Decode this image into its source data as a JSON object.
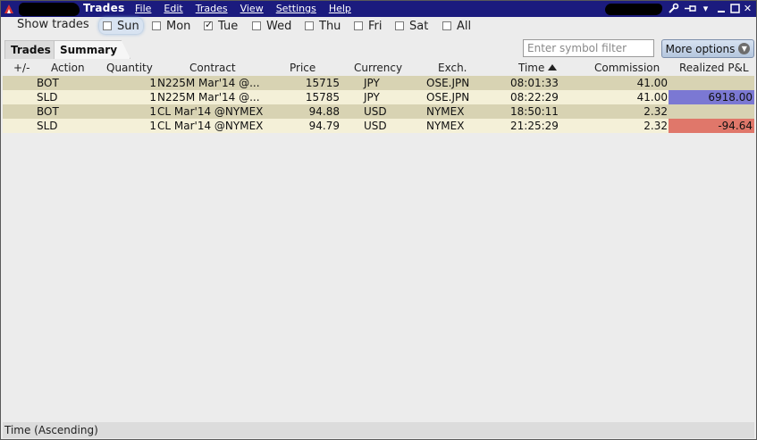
{
  "titlebar": {
    "title": "Trades",
    "menu": [
      "File",
      "Edit",
      "Trades",
      "View",
      "Settings",
      "Help"
    ],
    "controls": {
      "tools": "🔧",
      "pin": "⊣",
      "chevron": "▾",
      "minimize": "‗",
      "maximize": "□",
      "close": "✕"
    }
  },
  "days_row": {
    "label": "Show trades",
    "days": [
      {
        "label": "Sun",
        "checked": false,
        "focused": true
      },
      {
        "label": "Mon",
        "checked": false
      },
      {
        "label": "Tue",
        "checked": true
      },
      {
        "label": "Wed",
        "checked": false
      },
      {
        "label": "Thu",
        "checked": false
      },
      {
        "label": "Fri",
        "checked": false
      },
      {
        "label": "Sat",
        "checked": false
      },
      {
        "label": "All",
        "checked": false
      }
    ]
  },
  "tabs": {
    "trades": "Trades",
    "summary": "Summary"
  },
  "filter": {
    "placeholder": "Enter symbol filter",
    "value": ""
  },
  "more_options": {
    "label": "More options"
  },
  "table": {
    "columns": {
      "pm": "+/-",
      "action": "Action",
      "quantity": "Quantity",
      "contract": "Contract",
      "price": "Price",
      "currency": "Currency",
      "exch": "Exch.",
      "time": "Time",
      "commission": "Commission",
      "pnl": "Realized P&L"
    },
    "rows": [
      {
        "action": "BOT",
        "quantity": "1",
        "contract": "N225M Mar'14 @...",
        "price": "15715",
        "currency": "JPY",
        "exch": "OSE.JPN",
        "time": "08:01:33",
        "commission": "41.00",
        "pnl": "",
        "pnl_color": ""
      },
      {
        "action": "SLD",
        "quantity": "1",
        "contract": "N225M Mar'14 @...",
        "price": "15785",
        "currency": "JPY",
        "exch": "OSE.JPN",
        "time": "08:22:29",
        "commission": "41.00",
        "pnl": "6918.00",
        "pnl_color": "#7b78d3"
      },
      {
        "action": "BOT",
        "quantity": "1",
        "contract": "CL Mar'14 @NYMEX",
        "price": "94.88",
        "currency": "USD",
        "exch": "NYMEX",
        "time": "18:50:11",
        "commission": "2.32",
        "pnl": "",
        "pnl_color": ""
      },
      {
        "action": "SLD",
        "quantity": "1",
        "contract": "CL Mar'14 @NYMEX",
        "price": "94.79",
        "currency": "USD",
        "exch": "NYMEX",
        "time": "21:25:29",
        "commission": "2.32",
        "pnl": "-94.64",
        "pnl_color": "#e0776a"
      }
    ]
  },
  "status": {
    "text": "Time (Ascending)"
  }
}
